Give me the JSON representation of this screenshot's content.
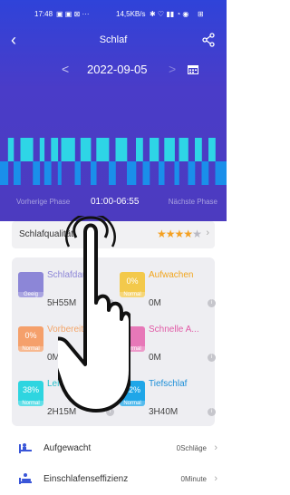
{
  "status_bar": {
    "time": "17:48",
    "indicators": "▣ ▣ ⊠ ···",
    "network": "14,5KB/s",
    "battery": "⊞"
  },
  "header": {
    "title": "Schlaf",
    "back_icon": "back-arrow-icon",
    "share_icon": "share-icon"
  },
  "date_nav": {
    "prev": "<",
    "date": "2022-09-05",
    "next": ">",
    "calendar_icon": "calendar-icon"
  },
  "phases": {
    "previous": "Vorherige Phase",
    "time_range": "01:00-06:55",
    "next": "Nächste Phase"
  },
  "quality": {
    "label": "Schlafqualität",
    "stars": 4,
    "max_stars": 5,
    "star_colors": {
      "on": "#f4a021",
      "off": "#b9b9c2"
    }
  },
  "stats": [
    {
      "name": "Schlafdauer",
      "value": "5H55M",
      "percent": "",
      "status": "Geeig",
      "color": "#8c86d7",
      "name_color": "#8c86d7"
    },
    {
      "name": "Aufwachen",
      "value": "0M",
      "percent": "0%",
      "status": "Normal",
      "color": "#f3c94b",
      "name_color": "#f2a51c"
    },
    {
      "name": "Vorbereitung",
      "value": "0M",
      "percent": "0%",
      "status": "Normal",
      "color": "#f5a06b",
      "name_color": "#f3a56a"
    },
    {
      "name": "Schnelle A...",
      "value": "0M",
      "percent": "",
      "status": "Normal",
      "color": "#e778b8",
      "name_color": "#e15aa6"
    },
    {
      "name": "Leichter Sc...",
      "value": "2H15M",
      "percent": "38%",
      "status": "Normal",
      "color": "#2ed5e0",
      "name_color": "#25c0cc"
    },
    {
      "name": "Tiefschlaf",
      "value": "3H40M",
      "percent": "62%",
      "status": "Normal",
      "color": "#1fa6e8",
      "name_color": "#1d8fd8"
    }
  ],
  "list": [
    {
      "label": "Aufgewacht",
      "value": "0Schläge",
      "icon": "bed-wake-icon"
    },
    {
      "label": "Einschlafenseffizienz",
      "value": "0Minute",
      "icon": "sleep-efficiency-icon"
    }
  ],
  "sleep_chart_segments": [
    {
      "t": 0.0,
      "d": 0.035,
      "level": "deep"
    },
    {
      "t": 0.035,
      "d": 0.025,
      "level": "light"
    },
    {
      "t": 0.06,
      "d": 0.03,
      "level": "deep"
    },
    {
      "t": 0.09,
      "d": 0.055,
      "level": "light"
    },
    {
      "t": 0.145,
      "d": 0.03,
      "level": "deep"
    },
    {
      "t": 0.175,
      "d": 0.02,
      "level": "light"
    },
    {
      "t": 0.195,
      "d": 0.03,
      "level": "deep"
    },
    {
      "t": 0.225,
      "d": 0.03,
      "level": "light"
    },
    {
      "t": 0.255,
      "d": 0.015,
      "level": "deep"
    },
    {
      "t": 0.27,
      "d": 0.06,
      "level": "light"
    },
    {
      "t": 0.33,
      "d": 0.025,
      "level": "deep"
    },
    {
      "t": 0.355,
      "d": 0.045,
      "level": "light"
    },
    {
      "t": 0.4,
      "d": 0.025,
      "level": "deep"
    },
    {
      "t": 0.425,
      "d": 0.055,
      "level": "light"
    },
    {
      "t": 0.48,
      "d": 0.03,
      "level": "deep"
    },
    {
      "t": 0.51,
      "d": 0.05,
      "level": "light"
    },
    {
      "t": 0.56,
      "d": 0.04,
      "level": "deep"
    },
    {
      "t": 0.6,
      "d": 0.03,
      "level": "light"
    },
    {
      "t": 0.63,
      "d": 0.03,
      "level": "deep"
    },
    {
      "t": 0.66,
      "d": 0.04,
      "level": "light"
    },
    {
      "t": 0.7,
      "d": 0.025,
      "level": "deep"
    },
    {
      "t": 0.725,
      "d": 0.045,
      "level": "light"
    },
    {
      "t": 0.77,
      "d": 0.02,
      "level": "deep"
    },
    {
      "t": 0.79,
      "d": 0.04,
      "level": "light"
    },
    {
      "t": 0.83,
      "d": 0.03,
      "level": "deep"
    },
    {
      "t": 0.86,
      "d": 0.03,
      "level": "light"
    },
    {
      "t": 0.89,
      "d": 0.03,
      "level": "deep"
    },
    {
      "t": 0.92,
      "d": 0.03,
      "level": "light"
    },
    {
      "t": 0.95,
      "d": 0.05,
      "level": "deep"
    }
  ],
  "colors": {
    "light": "#2ed5e6",
    "deep": "#1a8fea",
    "background": "#3b48d3"
  }
}
